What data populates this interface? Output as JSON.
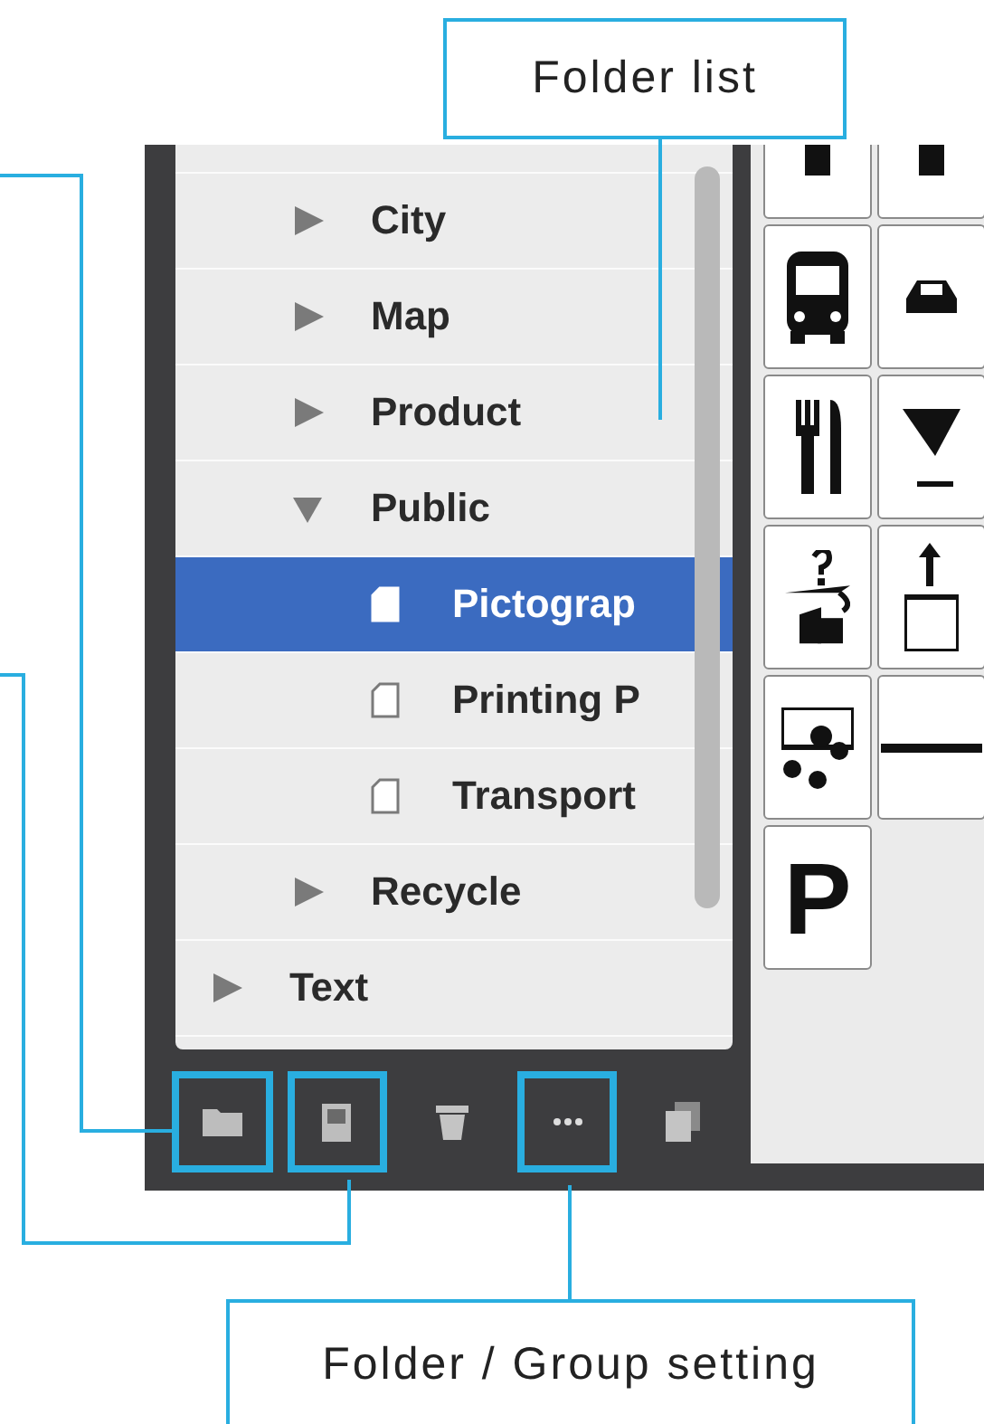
{
  "callouts": [
    {
      "label": "Folder list"
    },
    {
      "label": "Folder / Group setting"
    }
  ],
  "folder_list": {
    "items": [
      {
        "children": [
          {
            "kind": "folder",
            "label": "City",
            "expanded": false,
            "selected": false
          },
          {
            "kind": "folder",
            "label": "Map",
            "expanded": false,
            "selected": false
          },
          {
            "kind": "folder",
            "label": "Product",
            "expanded": false,
            "selected": false
          },
          {
            "kind": "folder",
            "label": "Public",
            "expanded": true,
            "selected": false,
            "children": [
              {
                "kind": "document",
                "label": "Pictograp",
                "selected": true
              },
              {
                "kind": "document",
                "label": "Printing P",
                "selected": false
              },
              {
                "kind": "document",
                "label": "Transport",
                "selected": false
              }
            ]
          },
          {
            "kind": "folder",
            "label": "Recycle",
            "expanded": false,
            "selected": false
          }
        ]
      },
      {
        "kind": "folder",
        "label": "Text",
        "expanded": false,
        "selected": false
      }
    ]
  },
  "pictogram_grid": {
    "cells": [
      {
        "kind": "stem"
      },
      {
        "kind": "stem"
      },
      {
        "kind": "bus"
      },
      {
        "kind": "car"
      },
      {
        "kind": "dining"
      },
      {
        "kind": "drink"
      },
      {
        "kind": "lost-property"
      },
      {
        "kind": "elevator"
      },
      {
        "kind": "money"
      },
      {
        "kind": "dash"
      },
      {
        "kind": "letter",
        "label": "P"
      }
    ]
  },
  "toolbar": {
    "buttons": [
      {
        "kind": "folder",
        "highlighted": true
      },
      {
        "kind": "document",
        "highlighted": true
      },
      {
        "kind": "trash",
        "highlighted": false
      },
      {
        "kind": "more",
        "highlighted": true
      },
      {
        "kind": "duplicate",
        "highlighted": false
      }
    ]
  }
}
